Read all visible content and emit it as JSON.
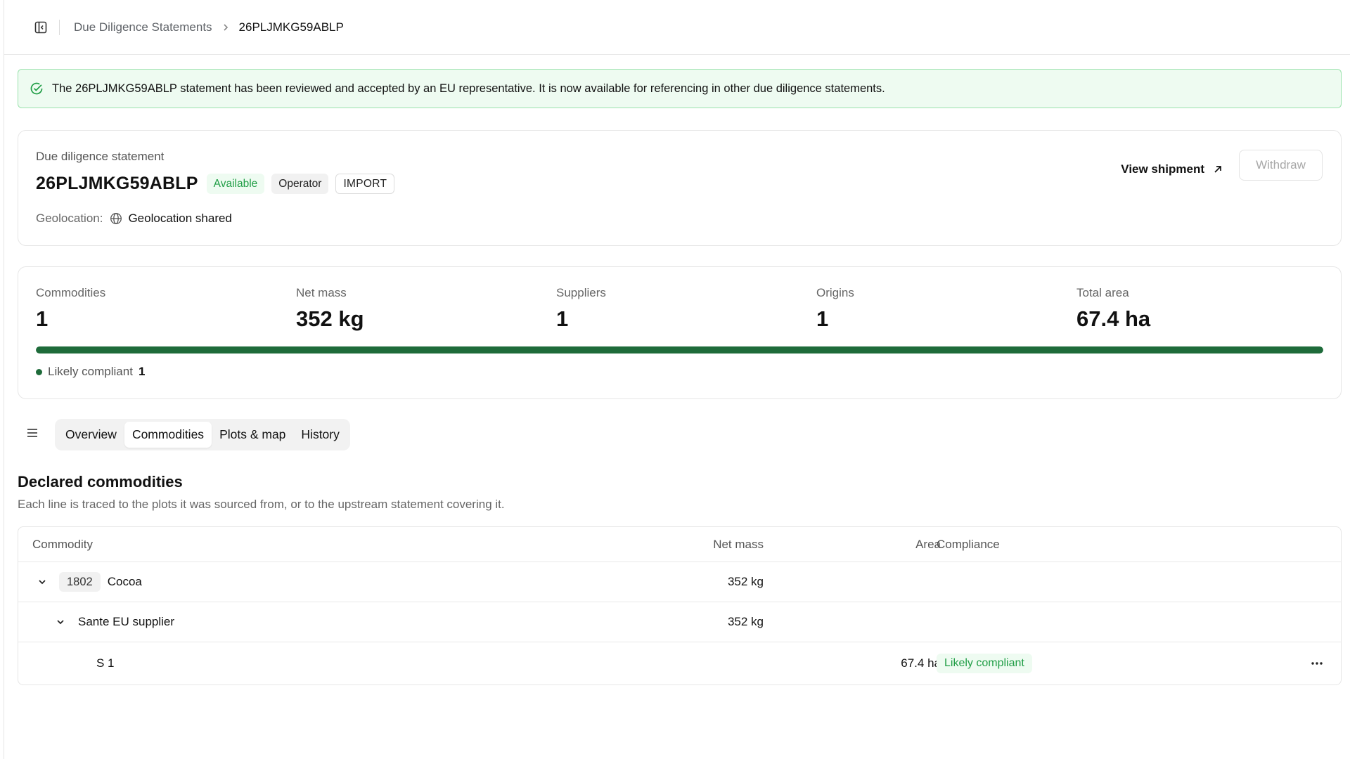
{
  "breadcrumb": {
    "parent": "Due Diligence Statements",
    "current": "26PLJMKG59ABLP"
  },
  "banner": {
    "message": "The 26PLJMKG59ABLP statement has been reviewed and accepted by an EU representative. It is now available for referencing in other due diligence statements.",
    "icon": "check-circle-icon",
    "color": "#1f9d45"
  },
  "statement": {
    "label": "Due diligence statement",
    "id": "26PLJMKG59ABLP",
    "badges": {
      "status": "Available",
      "role": "Operator",
      "type": "IMPORT"
    },
    "geolocation_label": "Geolocation:",
    "geolocation_value": "Geolocation shared",
    "view_shipment_label": "View shipment",
    "withdraw_label": "Withdraw"
  },
  "stats": {
    "items": [
      {
        "label": "Commodities",
        "value": "1"
      },
      {
        "label": "Net mass",
        "value": "352 kg"
      },
      {
        "label": "Suppliers",
        "value": "1"
      },
      {
        "label": "Origins",
        "value": "1"
      },
      {
        "label": "Total area",
        "value": "67.4 ha"
      }
    ],
    "compliance_fraction": 1.0,
    "compliance_color": "#1e6b3a",
    "legend_label": "Likely compliant",
    "legend_count": "1"
  },
  "tabs": [
    {
      "label": "Overview",
      "active": false
    },
    {
      "label": "Commodities",
      "active": true
    },
    {
      "label": "Plots & map",
      "active": false
    },
    {
      "label": "History",
      "active": false
    }
  ],
  "section": {
    "title": "Declared commodities",
    "subtitle": "Each line is traced to the plots it was sourced from, or to the upstream statement covering it."
  },
  "table": {
    "headers": {
      "commodity": "Commodity",
      "net_mass": "Net mass",
      "area": "Area",
      "compliance": "Compliance"
    },
    "rows": [
      {
        "hs_code": "1802",
        "name": "Cocoa",
        "net_mass": "352 kg"
      },
      {
        "name": "Sante EU supplier",
        "net_mass": "352 kg"
      },
      {
        "name": "S 1",
        "area": "67.4 ha",
        "compliance": "Likely compliant"
      }
    ]
  }
}
